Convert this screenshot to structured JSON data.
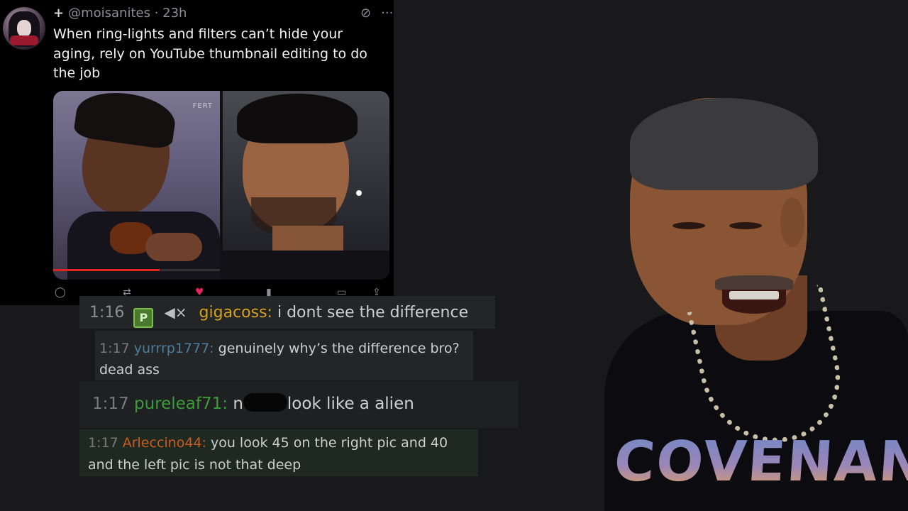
{
  "tweet": {
    "handle": "@moisanites",
    "age": "23h",
    "text": "When ring-lights and filters can’t hide your aging, rely on YouTube thumbnail editing to do the job",
    "photo_logo": "FERT",
    "video_progress": 0.64
  },
  "chat": [
    {
      "time": "1:16",
      "badge": "P",
      "user": "gigacoss:",
      "text": "i dont see the difference"
    },
    {
      "time": "1:17",
      "user": "yurrrp1777:",
      "text": "genuinely why’s the difference bro? dead ass"
    },
    {
      "time": "1:17",
      "user": "pureleaf71:",
      "text_prefix": "n",
      "text": "look like a alien"
    },
    {
      "time": "1:17",
      "user": "Arleccino44:",
      "text": "you look 45 on the right pic and 40 and the left pic is not that deep"
    }
  ],
  "shirt_print": "COVENANT",
  "colors": {
    "gigacoss": "#d3a224",
    "yurrrp1777": "#4c7f9e",
    "pureleaf71": "#3c9b3a",
    "Arleccino44": "#cc5c1e"
  }
}
